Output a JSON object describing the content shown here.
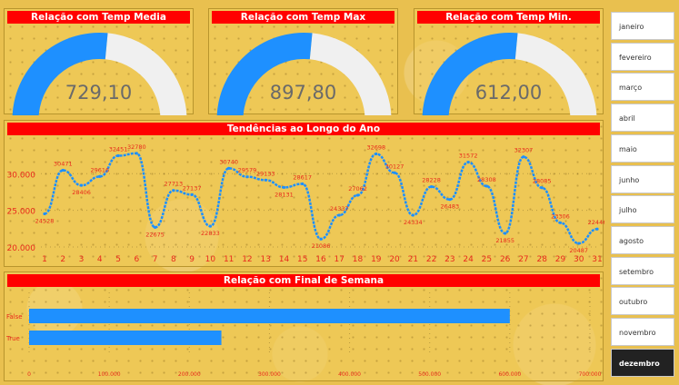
{
  "gauges": [
    {
      "title": "Relação com Temp Media",
      "value_label": "729,10",
      "fraction": 0.53
    },
    {
      "title": "Relação com Temp Max",
      "value_label": "897,80",
      "fraction": 0.53
    },
    {
      "title": "Relação com Temp Min.",
      "value_label": "612,00",
      "fraction": 0.53
    }
  ],
  "colors": {
    "accent": "#1e90ff",
    "title_bg": "#ff0000",
    "track": "#f0f0f0",
    "label": "#e8291c",
    "slicer_selected": "#222222"
  },
  "line_panel": {
    "title": "Tendências ao Longo do Ano"
  },
  "bar_panel": {
    "title": "Relação com Final de Semana"
  },
  "chart_data": [
    {
      "type": "line",
      "title": "Tendências ao Longo do Ano",
      "x": [
        1,
        2,
        3,
        4,
        5,
        6,
        7,
        8,
        9,
        10,
        11,
        12,
        13,
        14,
        15,
        16,
        17,
        18,
        19,
        20,
        21,
        22,
        23,
        24,
        25,
        26,
        27,
        28,
        29,
        30,
        31
      ],
      "series": [
        {
          "values": [
            24528,
            30471,
            28406,
            29616,
            32451,
            32780,
            22675,
            27713,
            27137,
            22833,
            30740,
            29579,
            29133,
            28131,
            28617,
            21086,
            24337,
            27062,
            32698,
            30127,
            24334,
            28228,
            26483,
            31572,
            28308,
            21855,
            32307,
            28085,
            23306,
            20487,
            22446
          ]
        }
      ],
      "data_labels": [
        "24528",
        "30471",
        "28406",
        "29616",
        "32451",
        "32780",
        "22675",
        "27713",
        "27137",
        "22833",
        "30740",
        "29579",
        "29133",
        "28131",
        "28617",
        "21086",
        "24337",
        "27062",
        "32698",
        "30127",
        "24334",
        "28228",
        "26483",
        "31572",
        "28308",
        "21855",
        "32307",
        "28085",
        "23306",
        "20487",
        "22446"
      ],
      "x_tick_labels": [
        "1",
        "2",
        "3",
        "4",
        "5",
        "6",
        "7",
        "8",
        "9",
        "10",
        "11",
        "12",
        "13",
        "14",
        "15",
        "16",
        "17",
        "18",
        "19",
        "20",
        "21",
        "22",
        "23",
        "24",
        "25",
        "26",
        "27",
        "28",
        "29",
        "30",
        "31"
      ],
      "y_tick_labels": [
        "20.000",
        "25.000",
        "30.000"
      ],
      "y_ticks": [
        20000,
        25000,
        30000
      ],
      "ylim": [
        19500,
        34500
      ],
      "grid": true
    },
    {
      "type": "bar",
      "orientation": "horizontal",
      "title": "Relação com Final de Semana",
      "categories": [
        "False",
        "True"
      ],
      "values": [
        600000,
        240000
      ],
      "x_tick_labels": [
        "0",
        "100.000",
        "200.000",
        "300.000",
        "400.000",
        "500.000",
        "600.000",
        "700.000"
      ],
      "x_ticks": [
        0,
        100000,
        200000,
        300000,
        400000,
        500000,
        600000,
        700000
      ],
      "xlim": [
        0,
        700000
      ],
      "grid": true
    }
  ],
  "slicer": {
    "months": [
      "janeiro",
      "fevereiro",
      "março",
      "abril",
      "maio",
      "junho",
      "julho",
      "agosto",
      "setembro",
      "outubro",
      "novembro",
      "dezembro"
    ],
    "selected": "dezembro"
  }
}
